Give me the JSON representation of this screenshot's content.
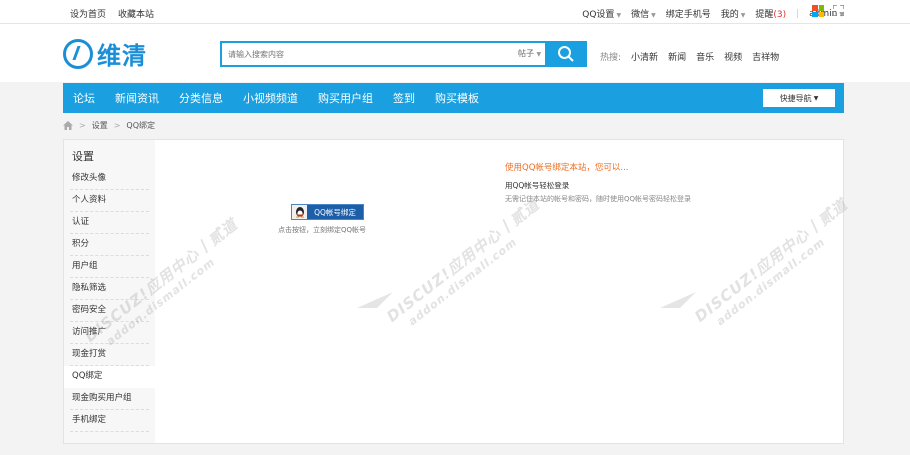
{
  "topbar": {
    "left_links": [
      "设为首页",
      "收藏本站"
    ],
    "right": {
      "qq_settings": "QQ设置",
      "wechat": "微信",
      "bind_phone": "绑定手机号",
      "mine": "我的",
      "notify": "提醒",
      "notify_count": "(3)",
      "separator": "|",
      "user": "admin"
    }
  },
  "header": {
    "logo_text": "维清",
    "search": {
      "placeholder": "请输入搜索内容",
      "type": "帖子"
    },
    "hot": {
      "label": "热搜:",
      "items": [
        "小清新",
        "新闻",
        "音乐",
        "视频",
        "吉祥物"
      ]
    }
  },
  "nav": {
    "items": [
      "论坛",
      "新闻资讯",
      "分类信息",
      "小视频频道",
      "购买用户组",
      "签到",
      "购买模板"
    ],
    "quick_nav": "快捷导航"
  },
  "breadcrumb": {
    "sep": ">",
    "items": [
      "设置",
      "QQ绑定"
    ]
  },
  "sidebar": {
    "title": "设置",
    "items": [
      "修改头像",
      "个人资料",
      "认证",
      "积分",
      "用户组",
      "隐私筛选",
      "密码安全",
      "访问推广",
      "现金打赏",
      "QQ绑定",
      "现金购买用户组",
      "手机绑定"
    ],
    "active_index": 9
  },
  "content": {
    "qq_button": "QQ帐号绑定",
    "qq_hint": "点击按钮，立刻绑定QQ帐号",
    "info_title": "使用QQ帐号绑定本站，您可以...",
    "info_sub": "用QQ帐号轻松登录",
    "info_desc": "无需记住本站的帐号和密码，随时使用QQ帐号密码轻松登录"
  },
  "watermark": {
    "line1": "DISCUZ!应用中心丨贰道",
    "line2": "addon.dismall.com"
  },
  "colors": {
    "brand": "#1a9fe0",
    "logo": "#1a8fd8",
    "highlight": "#f26c22",
    "notify": "#e03131",
    "qq_button": "#1d5ea8"
  },
  "icons": [
    "chevron-down-icon",
    "search-icon",
    "windows-logo-icon",
    "fullscreen-icon",
    "home-icon",
    "qq-penguin-icon"
  ]
}
